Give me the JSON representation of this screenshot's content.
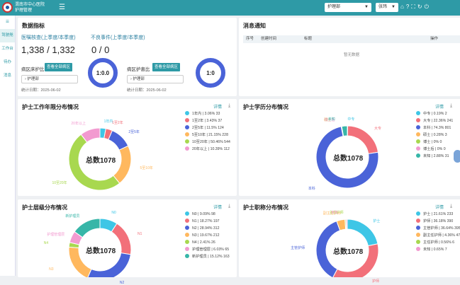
{
  "app": {
    "org": "渭南市中心医院",
    "title": "护理管理",
    "menu": "☰",
    "dept": "护理部",
    "user": "张玮",
    "icons": [
      "lock",
      "help",
      "expand",
      "refresh",
      "power"
    ]
  },
  "sidebar": [
    {
      "icon": "☰",
      "label": ""
    },
    {
      "label": "驾驶舱"
    },
    {
      "label": "工作台"
    },
    {
      "label": "待办"
    },
    {
      "label": "消息"
    }
  ],
  "indicators": {
    "title": "数据指标",
    "t1": "医嘱核查(上季度/本季度)",
    "v1": "1,338 / 1,332",
    "t2": "不良事件(上季度/本季度)",
    "v2": "0 / 0",
    "bed": {
      "label": "病区床护比",
      "btn": "查看全部病区",
      "dept": "护理部",
      "date": "统计日期：2025-06-02",
      "ratio": "1:0.0"
    },
    "nurse": {
      "label": "病区护患比",
      "btn": "查看全部病区",
      "dept": "护理部",
      "date": "统计日期：2025-06-02",
      "ratio": "1:0"
    }
  },
  "notice": {
    "title": "消息通知",
    "cols": [
      "序号",
      "创建时间",
      "标题",
      "操作"
    ],
    "empty": "暂无数据"
  },
  "colors": [
    "#3ec6e6",
    "#f2707a",
    "#4a63d8",
    "#ffb85e",
    "#a8d84f",
    "#f29ad0",
    "#37b6a8",
    "#9e7be6"
  ],
  "charts": [
    {
      "title": "护士工作年限分布情况",
      "detail": "详情",
      "total": "总数1078",
      "chart_data": {
        "type": "pie",
        "categories": [
          "1年内",
          "1至2年",
          "2至5年",
          "5至10年",
          "10至20年",
          "20年以上"
        ],
        "values": [
          33,
          37,
          124,
          228,
          544,
          112
        ],
        "percents": [
          "3.06%",
          "3.43%",
          "11.5%",
          "21.15%",
          "50.46%",
          "10.39%"
        ],
        "colors": [
          "#3ec6e6",
          "#f2707a",
          "#4a63d8",
          "#ffb85e",
          "#a8d84f",
          "#f29ad0"
        ]
      },
      "outer": [
        "1年内",
        "1至2年",
        "2至5年",
        "5至10年",
        "10至20年",
        "20年以上"
      ]
    },
    {
      "title": "护士学历分布情况",
      "detail": "详情",
      "total": "总数1078",
      "chart_data": {
        "type": "pie",
        "categories": [
          "中专",
          "大专",
          "本科",
          "硕士",
          "博士",
          "博士后",
          "未知"
        ],
        "values": [
          2,
          241,
          801,
          3,
          0,
          0,
          31
        ],
        "percents": [
          "0.19%",
          "22.36%",
          "74.3%",
          "0.28%",
          "0%",
          "0%",
          "2.88%"
        ],
        "colors": [
          "#3ec6e6",
          "#f2707a",
          "#4a63d8",
          "#ffb85e",
          "#a8d84f",
          "#f29ad0",
          "#37b6a8"
        ]
      },
      "outer": [
        "中专",
        "大专",
        "本科",
        "硕士",
        "博士",
        "博士后",
        "未知"
      ]
    },
    {
      "title": "护士层级分布情况",
      "detail": "详情",
      "total": "总数1078",
      "chart_data": {
        "type": "pie",
        "categories": [
          "N0",
          "N1",
          "N2",
          "N3",
          "N4",
          "护理管理层",
          "新护理员"
        ],
        "values": [
          98,
          197,
          312,
          212,
          26,
          65,
          163
        ],
        "percents": [
          "9.09%",
          "18.27%",
          "28.94%",
          "19.67%",
          "2.41%",
          "6.03%",
          "15.12%"
        ],
        "colors": [
          "#3ec6e6",
          "#f2707a",
          "#4a63d8",
          "#ffb85e",
          "#a8d84f",
          "#f29ad0",
          "#37b6a8"
        ]
      },
      "outer": [
        "N0",
        "N1",
        "N2",
        "N3",
        "N4",
        "护理管理层",
        "新护理员"
      ]
    },
    {
      "title": "护士职称分布情况",
      "detail": "详情",
      "total": "总数1078",
      "chart_data": {
        "type": "pie",
        "categories": [
          "护士",
          "护师",
          "主管护师",
          "副主任护师",
          "主任护师",
          "未知"
        ],
        "values": [
          233,
          390,
          395,
          47,
          6,
          7
        ],
        "percents": [
          "21.61%",
          "36.18%",
          "36.64%",
          "4.36%",
          "0.56%",
          "0.65%"
        ],
        "colors": [
          "#3ec6e6",
          "#f2707a",
          "#4a63d8",
          "#ffb85e",
          "#a8d84f",
          "#f29ad0"
        ]
      },
      "outer": [
        "护士",
        "护师",
        "主管护师",
        "副主任护师",
        "主任护师",
        "未知"
      ]
    }
  ]
}
